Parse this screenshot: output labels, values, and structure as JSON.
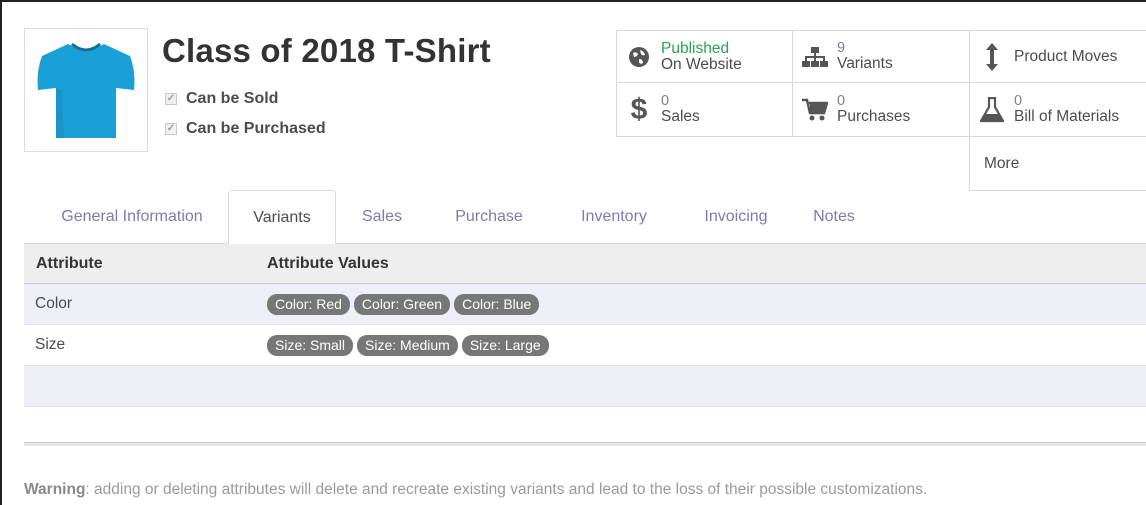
{
  "product": {
    "title": "Class of 2018 T-Shirt",
    "can_be_sold": "Can be Sold",
    "can_be_purchased": "Can be Purchased",
    "image_icon": "tshirt-image",
    "shirt_color": "#1a9fd6"
  },
  "smart_buttons": {
    "published": {
      "line1": "Published",
      "line2": "On Website",
      "icon": "globe-icon"
    },
    "variants": {
      "count": "9",
      "label": "Variants",
      "icon": "sitemap-icon"
    },
    "product_moves": {
      "label": "Product Moves",
      "icon": "arrows-vertical-icon"
    },
    "sales": {
      "count": "0",
      "label": "Sales",
      "icon": "dollar-icon"
    },
    "purchases": {
      "count": "0",
      "label": "Purchases",
      "icon": "cart-icon"
    },
    "bom": {
      "count": "0",
      "label": "Bill of Materials",
      "icon": "flask-icon"
    },
    "more": {
      "label": "More"
    }
  },
  "tabs": [
    {
      "label": "General Information"
    },
    {
      "label": "Variants"
    },
    {
      "label": "Sales"
    },
    {
      "label": "Purchase"
    },
    {
      "label": "Inventory"
    },
    {
      "label": "Invoicing"
    },
    {
      "label": "Notes"
    }
  ],
  "table": {
    "headers": [
      "Attribute",
      "Attribute Values"
    ],
    "rows": [
      {
        "attribute": "Color",
        "values": [
          "Color: Red",
          "Color: Green",
          "Color: Blue"
        ]
      },
      {
        "attribute": "Size",
        "values": [
          "Size: Small",
          "Size: Medium",
          "Size: Large"
        ]
      }
    ]
  },
  "warning": {
    "strong": "Warning",
    "text": ": adding or deleting attributes will delete and recreate existing variants and lead to the loss of their possible customizations."
  },
  "colors": {
    "accent": "#7c7bad",
    "published_green": "#28a745",
    "tag_bg": "#777777"
  }
}
